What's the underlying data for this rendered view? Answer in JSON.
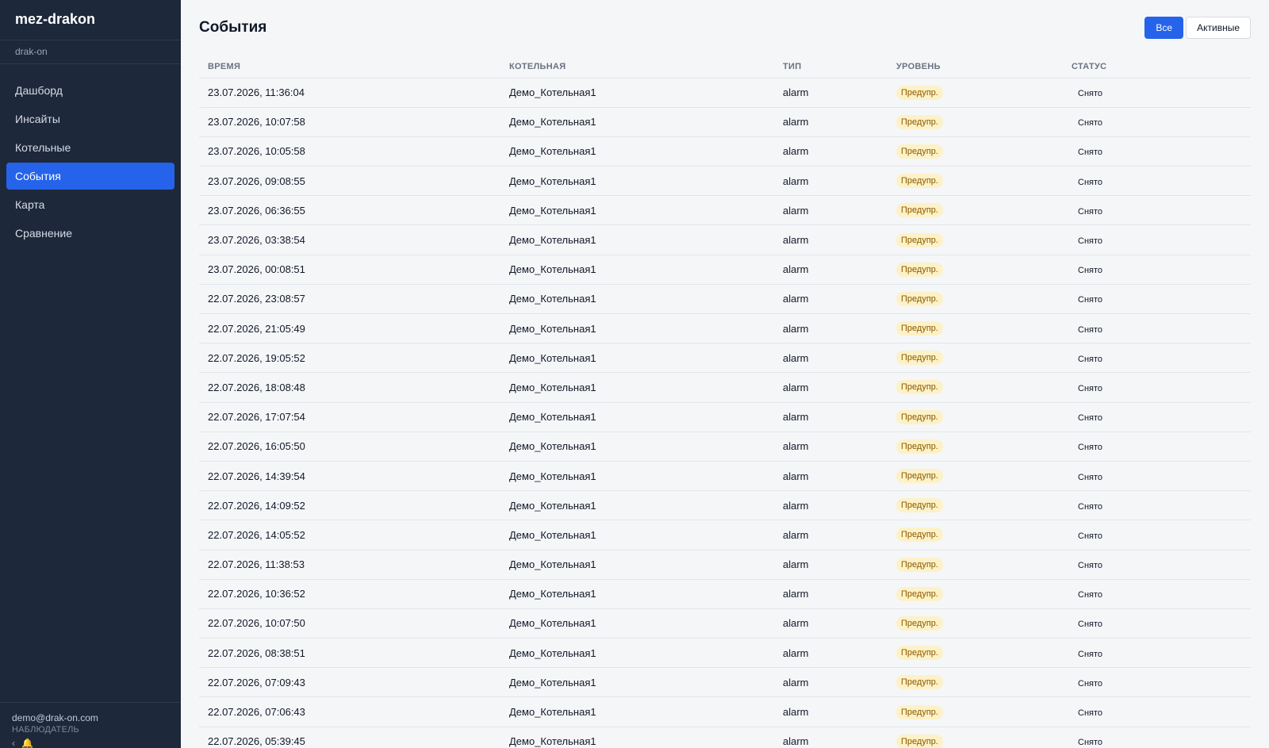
{
  "sidebar": {
    "brand": "mez-drakon",
    "org": "drak-on",
    "items": [
      {
        "label": "Дашборд",
        "active": false
      },
      {
        "label": "Инсайты",
        "active": false
      },
      {
        "label": "Котельные",
        "active": false
      },
      {
        "label": "События",
        "active": true
      },
      {
        "label": "Карта",
        "active": false
      },
      {
        "label": "Сравнение",
        "active": false
      }
    ],
    "user_email": "demo@drak-on.com",
    "user_role": "НАБЛЮДАТЕЛЬ",
    "footer_icons": [
      "collapse-chevron-icon",
      "bell-icon"
    ]
  },
  "page": {
    "title": "События",
    "filters": [
      {
        "label": "Все",
        "active": true
      },
      {
        "label": "Активные",
        "active": false
      }
    ]
  },
  "table": {
    "columns": [
      "ВРЕМЯ",
      "КОТЕЛЬНАЯ",
      "ТИП",
      "УРОВЕНЬ",
      "СТАТУС"
    ],
    "rows": [
      {
        "time": "23.07.2026, 11:36:04",
        "boiler": "Демо_Котельная1",
        "type": "alarm",
        "level": "Предупр.",
        "status": "Снято"
      },
      {
        "time": "23.07.2026, 10:07:58",
        "boiler": "Демо_Котельная1",
        "type": "alarm",
        "level": "Предупр.",
        "status": "Снято"
      },
      {
        "time": "23.07.2026, 10:05:58",
        "boiler": "Демо_Котельная1",
        "type": "alarm",
        "level": "Предупр.",
        "status": "Снято"
      },
      {
        "time": "23.07.2026, 09:08:55",
        "boiler": "Демо_Котельная1",
        "type": "alarm",
        "level": "Предупр.",
        "status": "Снято"
      },
      {
        "time": "23.07.2026, 06:36:55",
        "boiler": "Демо_Котельная1",
        "type": "alarm",
        "level": "Предупр.",
        "status": "Снято"
      },
      {
        "time": "23.07.2026, 03:38:54",
        "boiler": "Демо_Котельная1",
        "type": "alarm",
        "level": "Предупр.",
        "status": "Снято"
      },
      {
        "time": "23.07.2026, 00:08:51",
        "boiler": "Демо_Котельная1",
        "type": "alarm",
        "level": "Предупр.",
        "status": "Снято"
      },
      {
        "time": "22.07.2026, 23:08:57",
        "boiler": "Демо_Котельная1",
        "type": "alarm",
        "level": "Предупр.",
        "status": "Снято"
      },
      {
        "time": "22.07.2026, 21:05:49",
        "boiler": "Демо_Котельная1",
        "type": "alarm",
        "level": "Предупр.",
        "status": "Снято"
      },
      {
        "time": "22.07.2026, 19:05:52",
        "boiler": "Демо_Котельная1",
        "type": "alarm",
        "level": "Предупр.",
        "status": "Снято"
      },
      {
        "time": "22.07.2026, 18:08:48",
        "boiler": "Демо_Котельная1",
        "type": "alarm",
        "level": "Предупр.",
        "status": "Снято"
      },
      {
        "time": "22.07.2026, 17:07:54",
        "boiler": "Демо_Котельная1",
        "type": "alarm",
        "level": "Предупр.",
        "status": "Снято"
      },
      {
        "time": "22.07.2026, 16:05:50",
        "boiler": "Демо_Котельная1",
        "type": "alarm",
        "level": "Предупр.",
        "status": "Снято"
      },
      {
        "time": "22.07.2026, 14:39:54",
        "boiler": "Демо_Котельная1",
        "type": "alarm",
        "level": "Предупр.",
        "status": "Снято"
      },
      {
        "time": "22.07.2026, 14:09:52",
        "boiler": "Демо_Котельная1",
        "type": "alarm",
        "level": "Предупр.",
        "status": "Снято"
      },
      {
        "time": "22.07.2026, 14:05:52",
        "boiler": "Демо_Котельная1",
        "type": "alarm",
        "level": "Предупр.",
        "status": "Снято"
      },
      {
        "time": "22.07.2026, 11:38:53",
        "boiler": "Демо_Котельная1",
        "type": "alarm",
        "level": "Предупр.",
        "status": "Снято"
      },
      {
        "time": "22.07.2026, 10:36:52",
        "boiler": "Демо_Котельная1",
        "type": "alarm",
        "level": "Предупр.",
        "status": "Снято"
      },
      {
        "time": "22.07.2026, 10:07:50",
        "boiler": "Демо_Котельная1",
        "type": "alarm",
        "level": "Предупр.",
        "status": "Снято"
      },
      {
        "time": "22.07.2026, 08:38:51",
        "boiler": "Демо_Котельная1",
        "type": "alarm",
        "level": "Предупр.",
        "status": "Снято"
      },
      {
        "time": "22.07.2026, 07:09:43",
        "boiler": "Демо_Котельная1",
        "type": "alarm",
        "level": "Предупр.",
        "status": "Снято"
      },
      {
        "time": "22.07.2026, 07:06:43",
        "boiler": "Демо_Котельная1",
        "type": "alarm",
        "level": "Предупр.",
        "status": "Снято"
      },
      {
        "time": "22.07.2026, 05:39:45",
        "boiler": "Демо_Котельная1",
        "type": "alarm",
        "level": "Предупр.",
        "status": "Снято"
      }
    ]
  },
  "colors": {
    "sidebar_bg": "#1d283a",
    "accent": "#2563eb",
    "warning_badge_bg": "#fdf1c7",
    "warning_badge_text": "#8a5a00"
  }
}
